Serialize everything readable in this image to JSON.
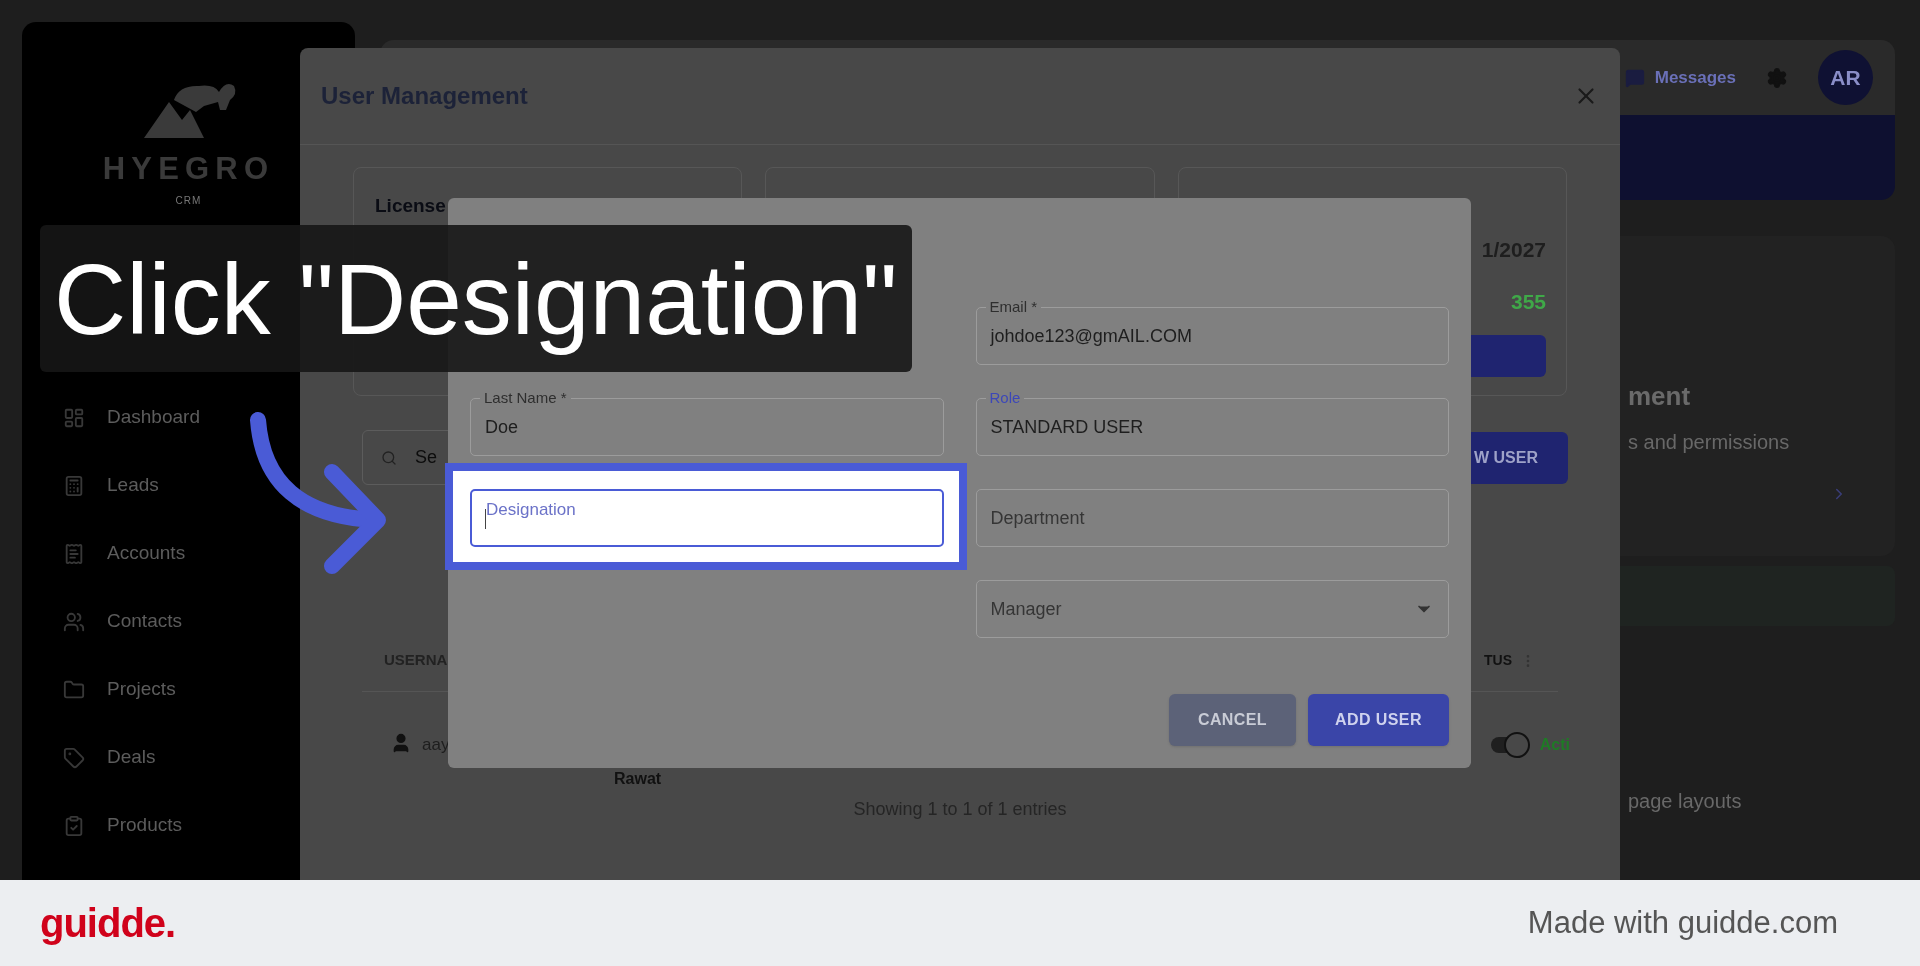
{
  "sidebar": {
    "logo": "HYEGRO",
    "logo_sub": "CRM",
    "items": [
      {
        "label": "Dashboard"
      },
      {
        "label": "Leads"
      },
      {
        "label": "Accounts"
      },
      {
        "label": "Contacts"
      },
      {
        "label": "Projects"
      },
      {
        "label": "Deals"
      },
      {
        "label": "Products"
      }
    ]
  },
  "topbar": {
    "messages": "Messages",
    "avatar": "AR"
  },
  "background_card": {
    "title": "ment",
    "description": "s and permissions"
  },
  "background_footer_text": "page layouts",
  "user_management": {
    "title": "User Management",
    "license_card_title": "License",
    "expiry_date": "1/2027",
    "count": "355",
    "search_placeholder": "Se",
    "new_user_button": "W USER",
    "columns": [
      "USERNA",
      "TUS"
    ],
    "row": {
      "username": "aay",
      "name": "Rawat",
      "active": true,
      "status": "Acti"
    },
    "footer": "Showing 1 to 1 of 1 entries"
  },
  "add_user": {
    "rows": [
      {
        "right": {
          "kind": "text",
          "label": "Email *",
          "value": "johdoe123@gmAIL.COM",
          "focused": false,
          "accent": false
        }
      },
      {
        "left": {
          "kind": "text",
          "label": "Last Name *",
          "value": "Doe",
          "focused": false,
          "accent": false
        },
        "right": {
          "kind": "text",
          "label": "Role",
          "value": "STANDARD USER",
          "focused": false,
          "accent": true
        }
      },
      {
        "left": {
          "kind": "text",
          "label": "Designation",
          "focused": true,
          "accent": false
        },
        "right": {
          "kind": "text",
          "label": "Department",
          "focused": false,
          "accent": false
        }
      },
      {
        "right": {
          "kind": "select",
          "label": "Manager",
          "focused": false,
          "accent": false
        }
      }
    ],
    "buttons": [
      {
        "label": "CANCEL",
        "kind": "secondary"
      },
      {
        "label": "ADD USER",
        "kind": "primary"
      }
    ]
  },
  "caption": "Click \"Designation\"",
  "footer": {
    "brand": "guidde.",
    "tagline": "Made with guidde.com"
  }
}
